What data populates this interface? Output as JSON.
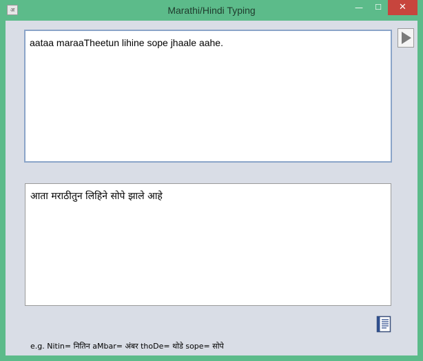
{
  "window": {
    "title": "Marathi/Hindi Typing",
    "app_icon_glyph": "अ",
    "minimize_glyph": "—",
    "maximize_glyph": "☐",
    "close_glyph": "✕"
  },
  "input": {
    "text": "aataa maraaTheetun lihine sope jhaale aahe."
  },
  "output": {
    "text": "आता मराठीतुन लिहिने सोपे झाले आहे"
  },
  "icons": {
    "convert": "play-arrow-icon",
    "copy": "document-copy-icon"
  },
  "hint": {
    "text": "e.g. Nitin= नितिन  aMbar= अंबर  thoDe= थोडे  sope= सोपे"
  }
}
